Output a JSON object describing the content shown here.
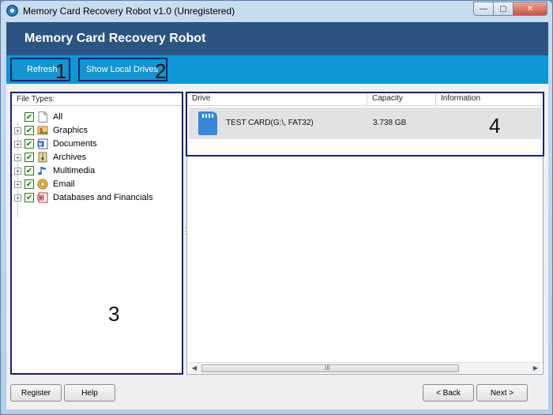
{
  "window": {
    "title": "Memory Card Recovery Robot v1.0 (Unregistered)",
    "controls": {
      "minimize": "—",
      "maximize": "▢",
      "close": "✕"
    }
  },
  "banner": {
    "title": "Memory Card Recovery Robot"
  },
  "toolbar": {
    "refresh_label": "Refresh",
    "show_local_drives_label": "Show Local Drives",
    "callout_1": "1",
    "callout_2": "2"
  },
  "file_types": {
    "header": "File Types:",
    "items": [
      {
        "label": "All",
        "icon": "blank-page-icon",
        "checked": true
      },
      {
        "label": "Graphics",
        "icon": "graphics-icon",
        "checked": true
      },
      {
        "label": "Documents",
        "icon": "word-document-icon",
        "checked": true
      },
      {
        "label": "Archives",
        "icon": "archive-icon",
        "checked": true
      },
      {
        "label": "Multimedia",
        "icon": "music-note-icon",
        "checked": true
      },
      {
        "label": "Email",
        "icon": "email-icon",
        "checked": true
      },
      {
        "label": "Databases and Financials",
        "icon": "database-icon",
        "checked": true
      }
    ],
    "callout_3": "3"
  },
  "drives": {
    "columns": [
      "Drive",
      "Capacity",
      "Information"
    ],
    "rows": [
      {
        "drive": "TEST CARD(G:\\, FAT32)",
        "capacity": "3.738 GB",
        "information": "",
        "icon": "sd-card-icon"
      }
    ],
    "callout_4": "4"
  },
  "scrollbar": {
    "left_arrow": "◀",
    "right_arrow": "▶",
    "grip": "III"
  },
  "buttons": {
    "register": "Register",
    "help": "Help",
    "back": "< Back",
    "next": "Next >"
  },
  "colors": {
    "banner": "#2c5480",
    "toolbar": "#0d97d6",
    "callout_frame": "#14246e",
    "selected_row": "#e2e2e2",
    "sd_card": "#3a86d8"
  }
}
